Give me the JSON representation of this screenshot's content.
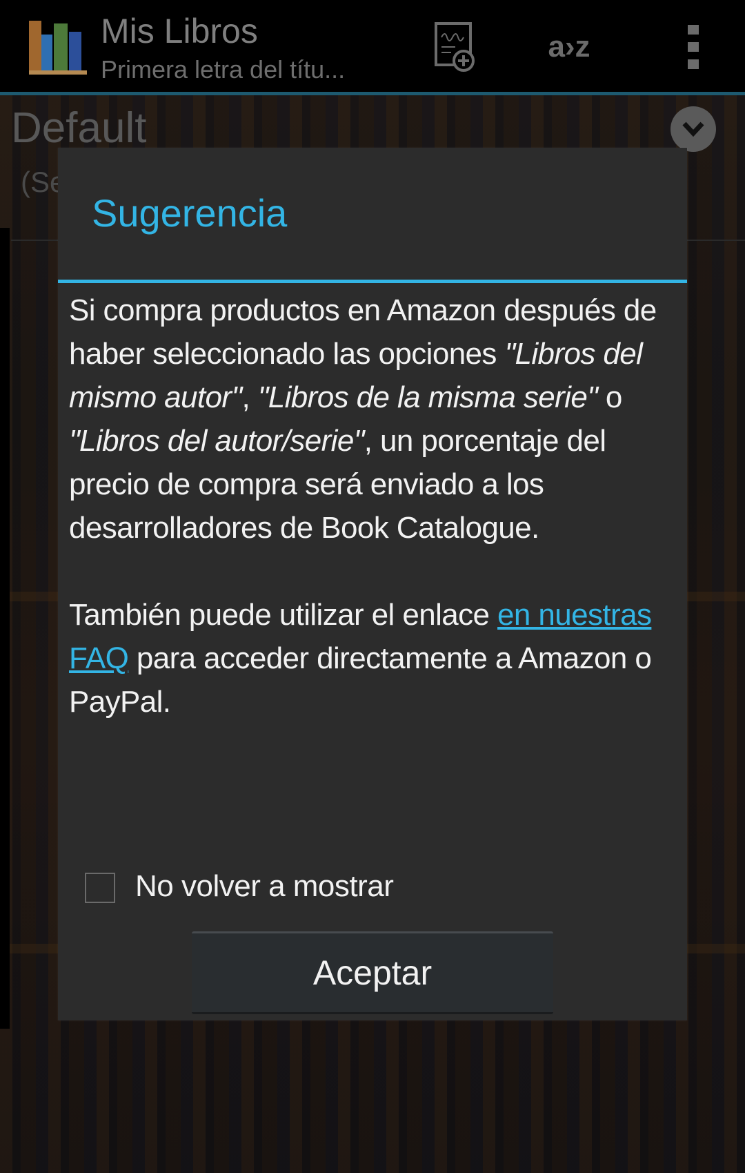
{
  "action_bar": {
    "title": "Mis Libros",
    "subtitle": "Primera letra del títu...",
    "sort_label": "a›z",
    "icons": [
      "bookshelf-app-icon",
      "add-book-icon",
      "sort-az-icon",
      "overflow-menu-icon"
    ]
  },
  "list": {
    "style_name": "Default",
    "style_sub": "(Se"
  },
  "dialog": {
    "title": "Sugerencia",
    "p1": [
      {
        "text": "Si compra productos en Amazon después de haber seleccionado las opciones ",
        "italic": false
      },
      {
        "text": "\"Libros del mismo autor\"",
        "italic": true
      },
      {
        "text": ", ",
        "italic": false
      },
      {
        "text": "\"Libros de la misma serie\"",
        "italic": true
      },
      {
        "text": " o ",
        "italic": false
      },
      {
        "text": "\"Libros del autor/serie\"",
        "italic": true
      },
      {
        "text": ", un porcentaje del precio de compra será enviado a los desarrolladores de Book Catalogue.",
        "italic": false
      }
    ],
    "p2_before": "También puede utilizar el enlace ",
    "p2_link": "en nuestras FAQ",
    "p2_after": " para acceder directamente a Amazon o PayPal.",
    "checkbox_label": "No volver a mostrar",
    "checkbox_checked": false,
    "ok_label": "Aceptar"
  },
  "colors": {
    "accent": "#33b5e5",
    "dialog_bg": "#2c2c2c",
    "header_line": "#1d5a70"
  }
}
